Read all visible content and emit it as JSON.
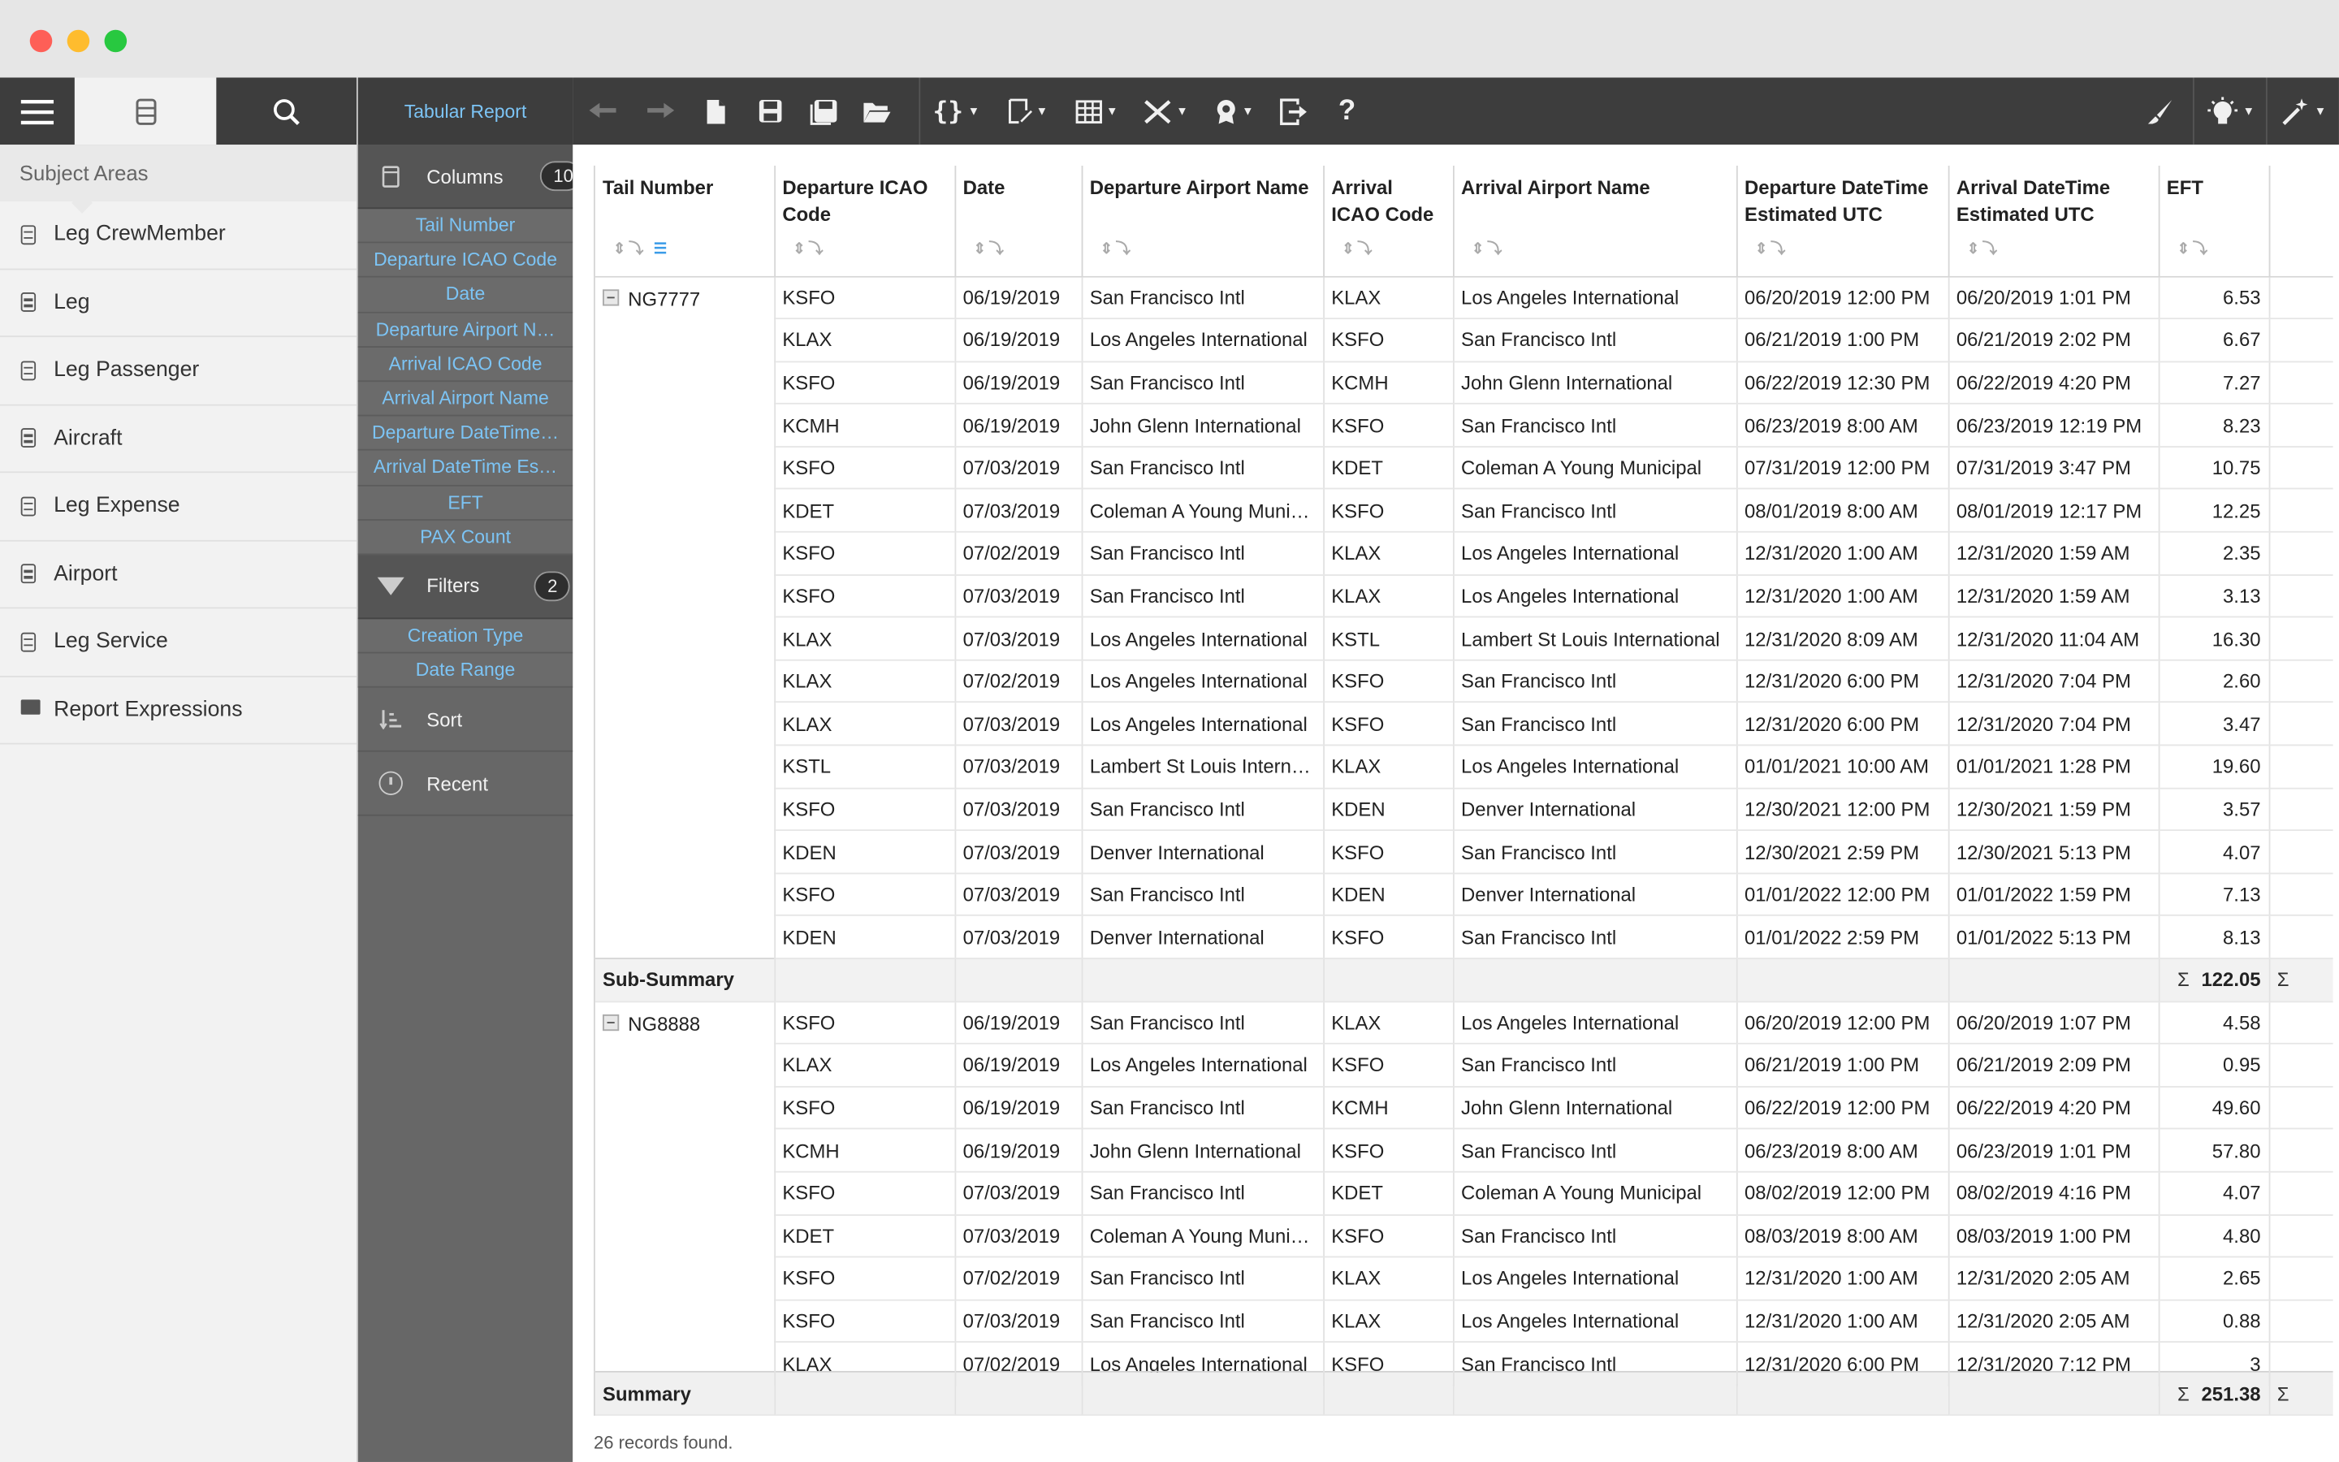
{
  "leftnav": {
    "header": "Subject Areas",
    "items": [
      {
        "label": "Leg CrewMember",
        "icon": "database-icon"
      },
      {
        "label": "Leg",
        "icon": "database-icon"
      },
      {
        "label": "Leg Passenger",
        "icon": "database-icon"
      },
      {
        "label": "Aircraft",
        "icon": "database-icon"
      },
      {
        "label": "Leg Expense",
        "icon": "database-icon"
      },
      {
        "label": "Airport",
        "icon": "database-icon"
      },
      {
        "label": "Leg Service",
        "icon": "database-icon"
      },
      {
        "label": "Report Expressions",
        "icon": "folder-icon"
      }
    ]
  },
  "midpanel": {
    "title": "Tabular Report",
    "columns_label": "Columns",
    "columns_count": "10",
    "columns": [
      "Tail Number",
      "Departure ICAO Code",
      "Date",
      "Departure Airport N…",
      "Arrival ICAO Code",
      "Arrival Airport Name",
      "Departure DateTime…",
      "Arrival DateTime Es…",
      "EFT",
      "PAX Count"
    ],
    "filters_label": "Filters",
    "filters_count": "2",
    "filters": [
      "Creation Type",
      "Date Range"
    ],
    "sort_label": "Sort",
    "recent_label": "Recent"
  },
  "table": {
    "headers": [
      "Tail Number",
      "Departure ICAO Code",
      "Date",
      "Departure Airport Name",
      "Arrival ICAO Code",
      "Arrival Airport Name",
      "Departure DateTime Estimated UTC",
      "Arrival DateTime Estimated UTC",
      "EFT"
    ],
    "groups": [
      {
        "tail": "NG7777",
        "rows": [
          [
            "KSFO",
            "06/19/2019",
            "San Francisco Intl",
            "KLAX",
            "Los Angeles International",
            "06/20/2019 12:00 PM",
            "06/20/2019 1:01 PM",
            "6.53"
          ],
          [
            "KLAX",
            "06/19/2019",
            "Los Angeles International",
            "KSFO",
            "San Francisco Intl",
            "06/21/2019 1:00 PM",
            "06/21/2019 2:02 PM",
            "6.67"
          ],
          [
            "KSFO",
            "06/19/2019",
            "San Francisco Intl",
            "KCMH",
            "John Glenn International",
            "06/22/2019 12:30 PM",
            "06/22/2019 4:20 PM",
            "7.27"
          ],
          [
            "KCMH",
            "06/19/2019",
            "John Glenn International",
            "KSFO",
            "San Francisco Intl",
            "06/23/2019 8:00 AM",
            "06/23/2019 12:19 PM",
            "8.23"
          ],
          [
            "KSFO",
            "07/03/2019",
            "San Francisco Intl",
            "KDET",
            "Coleman A Young Municipal",
            "07/31/2019 12:00 PM",
            "07/31/2019 3:47 PM",
            "10.75"
          ],
          [
            "KDET",
            "07/03/2019",
            "Coleman A Young Munic…",
            "KSFO",
            "San Francisco Intl",
            "08/01/2019 8:00 AM",
            "08/01/2019 12:17 PM",
            "12.25"
          ],
          [
            "KSFO",
            "07/02/2019",
            "San Francisco Intl",
            "KLAX",
            "Los Angeles International",
            "12/31/2020 1:00 AM",
            "12/31/2020 1:59 AM",
            "2.35"
          ],
          [
            "KSFO",
            "07/03/2019",
            "San Francisco Intl",
            "KLAX",
            "Los Angeles International",
            "12/31/2020 1:00 AM",
            "12/31/2020 1:59 AM",
            "3.13"
          ],
          [
            "KLAX",
            "07/03/2019",
            "Los Angeles International",
            "KSTL",
            "Lambert St Louis International",
            "12/31/2020 8:09 AM",
            "12/31/2020 11:04 AM",
            "16.30"
          ],
          [
            "KLAX",
            "07/02/2019",
            "Los Angeles International",
            "KSFO",
            "San Francisco Intl",
            "12/31/2020 6:00 PM",
            "12/31/2020 7:04 PM",
            "2.60"
          ],
          [
            "KLAX",
            "07/03/2019",
            "Los Angeles International",
            "KSFO",
            "San Francisco Intl",
            "12/31/2020 6:00 PM",
            "12/31/2020 7:04 PM",
            "3.47"
          ],
          [
            "KSTL",
            "07/03/2019",
            "Lambert St Louis Intern…",
            "KLAX",
            "Los Angeles International",
            "01/01/2021 10:00 AM",
            "01/01/2021 1:28 PM",
            "19.60"
          ],
          [
            "KSFO",
            "07/03/2019",
            "San Francisco Intl",
            "KDEN",
            "Denver International",
            "12/30/2021 12:00 PM",
            "12/30/2021 1:59 PM",
            "3.57"
          ],
          [
            "KDEN",
            "07/03/2019",
            "Denver International",
            "KSFO",
            "San Francisco Intl",
            "12/30/2021 2:59 PM",
            "12/30/2021 5:13 PM",
            "4.07"
          ],
          [
            "KSFO",
            "07/03/2019",
            "San Francisco Intl",
            "KDEN",
            "Denver International",
            "01/01/2022 12:00 PM",
            "01/01/2022 1:59 PM",
            "7.13"
          ],
          [
            "KDEN",
            "07/03/2019",
            "Denver International",
            "KSFO",
            "San Francisco Intl",
            "01/01/2022 2:59 PM",
            "01/01/2022 5:13 PM",
            "8.13"
          ]
        ],
        "subsummary_label": "Sub-Summary",
        "subsummary_value": "122.05"
      },
      {
        "tail": "NG8888",
        "rows": [
          [
            "KSFO",
            "06/19/2019",
            "San Francisco Intl",
            "KLAX",
            "Los Angeles International",
            "06/20/2019 12:00 PM",
            "06/20/2019 1:07 PM",
            "4.58"
          ],
          [
            "KLAX",
            "06/19/2019",
            "Los Angeles International",
            "KSFO",
            "San Francisco Intl",
            "06/21/2019 1:00 PM",
            "06/21/2019 2:09 PM",
            "0.95"
          ],
          [
            "KSFO",
            "06/19/2019",
            "San Francisco Intl",
            "KCMH",
            "John Glenn International",
            "06/22/2019 12:00 PM",
            "06/22/2019 4:20 PM",
            "49.60"
          ],
          [
            "KCMH",
            "06/19/2019",
            "John Glenn International",
            "KSFO",
            "San Francisco Intl",
            "06/23/2019 8:00 AM",
            "06/23/2019 1:01 PM",
            "57.80"
          ],
          [
            "KSFO",
            "07/03/2019",
            "San Francisco Intl",
            "KDET",
            "Coleman A Young Municipal",
            "08/02/2019 12:00 PM",
            "08/02/2019 4:16 PM",
            "4.07"
          ],
          [
            "KDET",
            "07/03/2019",
            "Coleman A Young Munic…",
            "KSFO",
            "San Francisco Intl",
            "08/03/2019 8:00 AM",
            "08/03/2019 1:00 PM",
            "4.80"
          ],
          [
            "KSFO",
            "07/02/2019",
            "San Francisco Intl",
            "KLAX",
            "Los Angeles International",
            "12/31/2020 1:00 AM",
            "12/31/2020 2:05 AM",
            "2.65"
          ],
          [
            "KSFO",
            "07/03/2019",
            "San Francisco Intl",
            "KLAX",
            "Los Angeles International",
            "12/31/2020 1:00 AM",
            "12/31/2020 2:05 AM",
            "0.88"
          ],
          [
            "KLAX",
            "07/02/2019",
            "Los Angeles International",
            "KSFO",
            "San Francisco Intl",
            "12/31/2020 6:00 PM",
            "12/31/2020 7:12 PM",
            "3"
          ]
        ]
      }
    ],
    "summary_label": "Summary",
    "summary_value": "251.38",
    "sigma": "Σ"
  },
  "footer": "26 records found."
}
